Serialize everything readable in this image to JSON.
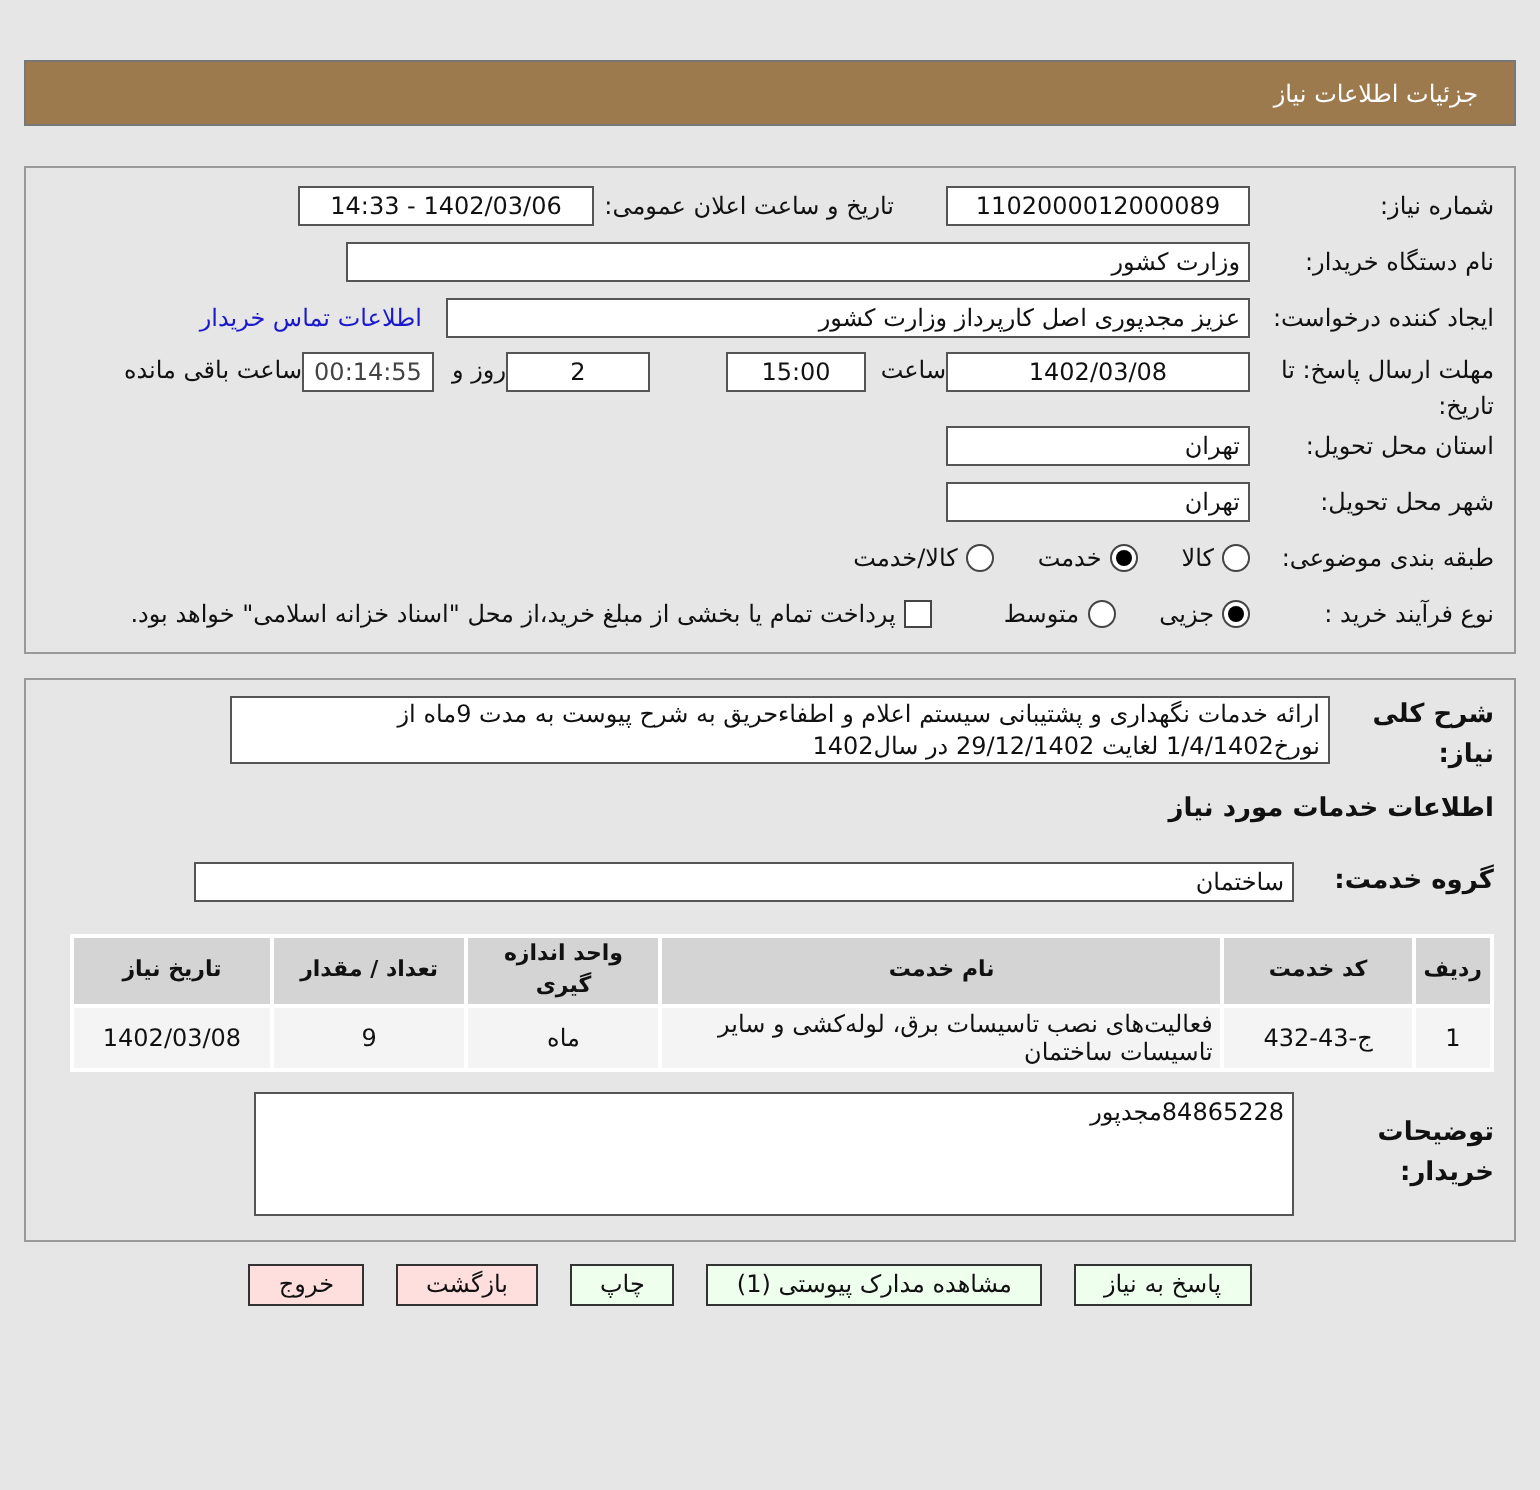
{
  "header": {
    "title": "جزئیات اطلاعات نیاز"
  },
  "need_number": {
    "label": "شماره نیاز:",
    "value": "1102000012000089"
  },
  "announce": {
    "label": "تاریخ و ساعت اعلان عمومی:",
    "value": "1402/03/06 - 14:33"
  },
  "buyer_org": {
    "label": "نام دستگاه خریدار:",
    "value": "وزارت کشور"
  },
  "creator": {
    "label": "ایجاد کننده درخواست:",
    "value": "عزیز مجدپوری اصل کارپرداز وزارت کشور",
    "link": "اطلاعات تماس خریدار"
  },
  "deadline": {
    "label": "مهلت ارسال پاسخ: تا تاریخ:",
    "date": "1402/03/08",
    "time_label": "ساعت",
    "time": "15:00",
    "days": "2",
    "days_label": "روز و",
    "remaining": "00:14:55",
    "remaining_label": "ساعت باقی مانده"
  },
  "province": {
    "label": "استان محل تحویل:",
    "value": "تهران"
  },
  "city": {
    "label": "شهر محل تحویل:",
    "value": "تهران"
  },
  "category": {
    "label": "طبقه بندی موضوعی:",
    "options": [
      {
        "label": "کالا",
        "selected": false
      },
      {
        "label": "خدمت",
        "selected": true
      },
      {
        "label": "کالا/خدمت",
        "selected": false
      }
    ]
  },
  "process": {
    "label": "نوع فرآیند خرید :",
    "options": [
      {
        "label": "جزیی",
        "selected": true
      },
      {
        "label": "متوسط",
        "selected": false
      }
    ],
    "payment": {
      "label": "پرداخت تمام یا بخشی از مبلغ خرید،از محل \"اسناد خزانه اسلامی\" خواهد بود.",
      "checked": false
    }
  },
  "description": {
    "label": "شرح کلی نیاز:",
    "value": "ارائه خدمات نگهداری و پشتیبانی سیستم اعلام و اطفاءحریق به شرح پیوست به مدت 9ماه از نورخ1/4/1402 لغایت 29/12/1402  در سال1402"
  },
  "services_title": "اطلاعات خدمات مورد نیاز",
  "service_group": {
    "label": "گروه خدمت:",
    "value": "ساختمان"
  },
  "table": {
    "columns": [
      "ردیف",
      "کد خدمت",
      "نام خدمت",
      "واحد اندازه گیری",
      "تعداد / مقدار",
      "تاریخ نیاز"
    ],
    "rows": [
      [
        "1",
        "ج-43-432",
        "فعالیت‌های نصب تاسیسات برق، لوله‌کشی و سایر تاسیسات ساختمان",
        "ماه",
        "9",
        "1402/03/08"
      ]
    ]
  },
  "buyer_notes": {
    "label": "توضیحات خریدار:",
    "value": "84865228مجدپور"
  },
  "buttons": [
    {
      "label": "پاسخ به نیاز",
      "kind": "primary"
    },
    {
      "label": "مشاهده مدارک پیوستی (1)",
      "kind": "primary"
    },
    {
      "label": "چاپ",
      "kind": "primary"
    },
    {
      "label": "بازگشت",
      "kind": "danger"
    },
    {
      "label": "خروج",
      "kind": "danger"
    }
  ]
}
